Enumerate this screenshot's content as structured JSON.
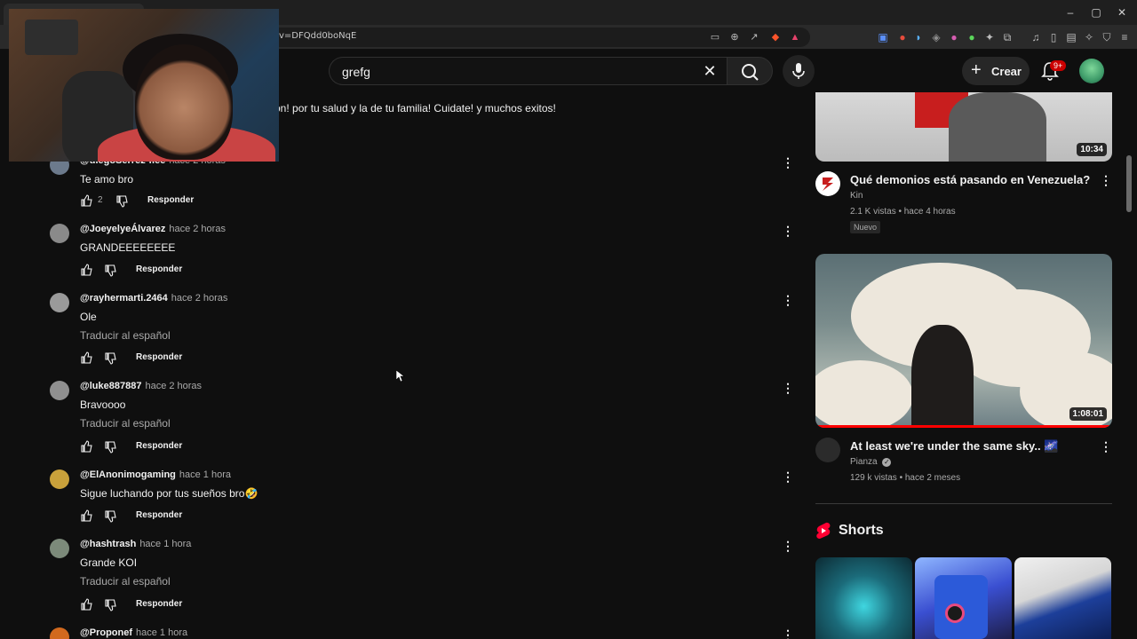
{
  "browser": {
    "url": "v=DFQdd0boNqE",
    "window_controls": [
      "–",
      "▢",
      "✕"
    ]
  },
  "header": {
    "search_value": "grefg",
    "create_label": "Crear",
    "notifications_badge": "9+"
  },
  "partial_comment_text": "ón! por tu salud y la de tu familia! Cuidate! y muchos exitos!",
  "comments": [
    {
      "user": "@diegoSerrez-flee",
      "time": "hace 2 horas",
      "text": "Te amo bro",
      "likes": "2",
      "translate": "",
      "reply": "Responder"
    },
    {
      "user": "@JoeyelyeÁlvarez",
      "time": "hace 2 horas",
      "text": "GRANDEEEEEEEE",
      "likes": "",
      "translate": "",
      "reply": "Responder"
    },
    {
      "user": "@rayhermarti.2464",
      "time": "hace 2 horas",
      "text": "Ole",
      "likes": "",
      "translate": "Traducir al español",
      "reply": "Responder"
    },
    {
      "user": "@luke887887",
      "time": "hace 2 horas",
      "text": "Bravoooo",
      "likes": "",
      "translate": "Traducir al español",
      "reply": "Responder"
    },
    {
      "user": "@ElAnonimogaming",
      "time": "hace 1 hora",
      "text": "Sigue luchando por tus sueños bro🤣",
      "likes": "",
      "translate": "",
      "reply": "Responder"
    },
    {
      "user": "@hashtrash",
      "time": "hace 1 hora",
      "text": "Grande KOI",
      "likes": "",
      "translate": "Traducir al español",
      "reply": "Responder"
    },
    {
      "user": "@Proponef",
      "time": "hace 1 hora",
      "text": "",
      "likes": "",
      "translate": "",
      "reply": ""
    }
  ],
  "sidebar": {
    "video1": {
      "duration": "10:34",
      "title": "Qué demonios está pasando en Venezuela?",
      "channel": "Kin",
      "meta": "2.1 K vistas • hace 4 horas",
      "badge": "Nuevo"
    },
    "video2": {
      "duration": "1:08:01",
      "title": "At least we're under the same sky.. 🌌",
      "channel": "Pianza",
      "meta": "129 k vistas • hace 2 meses",
      "progress_fraction": 1.0
    },
    "shorts_title": "Shorts"
  },
  "colors": {
    "background": "#0f0f0f",
    "text": "#f1f1f1",
    "muted": "#aaaaaa",
    "accent_red": "#ff0000"
  }
}
